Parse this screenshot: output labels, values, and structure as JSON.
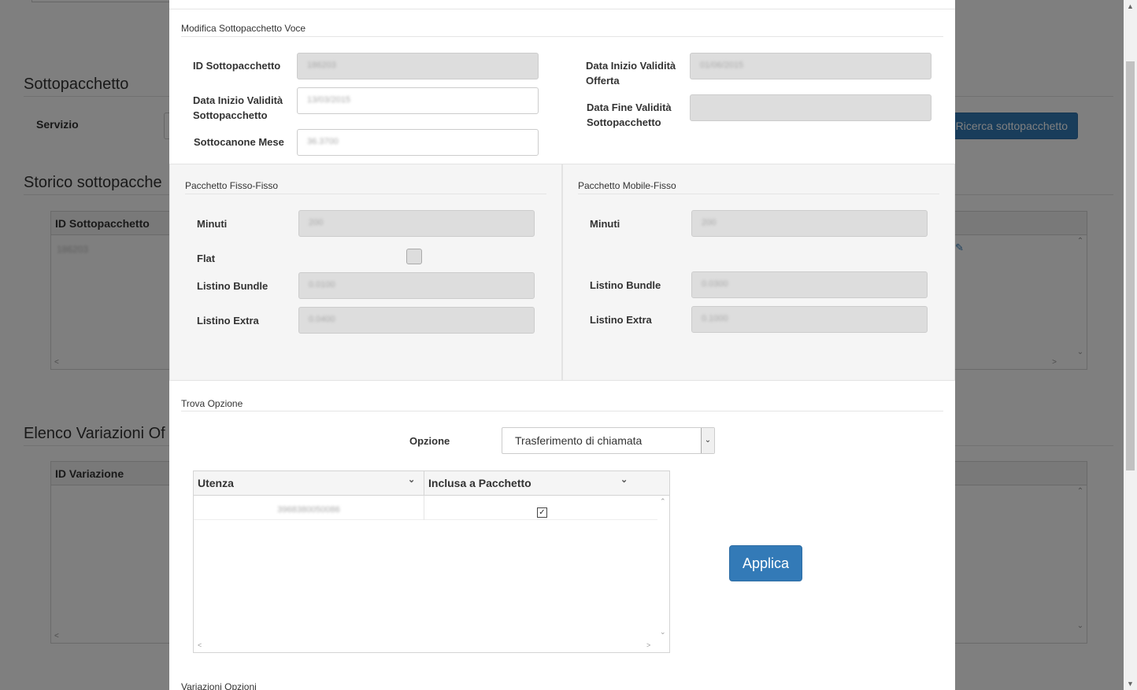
{
  "background": {
    "section_sottopacchetto": "Sottopacchetto",
    "label_servizio": "Servizio",
    "search_button": "Ricerca sottopacchetto",
    "section_storico": "Storico sottopacche",
    "storico_grid": {
      "col_id": "ID Sottopacchetto",
      "row_id": "186203"
    },
    "section_variazioni": "Elenco Variazioni Of",
    "variazioni_grid": {
      "col_id": "ID Variazione"
    }
  },
  "modal": {
    "section_title": "Modifica Sottopacchetto Voce",
    "fields": {
      "id_sottopacchetto": {
        "label": "ID Sottopacchetto",
        "value": "186203"
      },
      "data_inizio_sotto": {
        "label": "Data Inizio Validità Sottopacchetto",
        "value": "13/03/2015"
      },
      "sottocanone": {
        "label": "Sottocanone Mese",
        "value": "36.3700"
      },
      "data_inizio_offerta": {
        "label": "Data Inizio Validità Offerta",
        "value": "01/06/2015"
      },
      "data_fine_sotto": {
        "label": "Data Fine Validità Sottopacchetto",
        "value": ""
      }
    },
    "fisso": {
      "title": "Pacchetto Fisso-Fisso",
      "minuti_label": "Minuti",
      "minuti": "200",
      "flat_label": "Flat",
      "bundle_label": "Listino Bundle",
      "bundle": "0.0100",
      "extra_label": "Listino Extra",
      "extra": "0.0400"
    },
    "mobile": {
      "title": "Pacchetto Mobile-Fisso",
      "minuti_label": "Minuti",
      "minuti": "200",
      "bundle_label": "Listino Bundle",
      "bundle": "0.0300",
      "extra_label": "Listino Extra",
      "extra": "0.1000"
    },
    "trova": {
      "title": "Trova Opzione",
      "opzione_label": "Opzione",
      "opzione_selected": "Trasferimento di chiamata",
      "grid": {
        "col_utenza": "Utenza",
        "col_inclusa": "Inclusa a Pacchetto",
        "rows": [
          {
            "utenza": "3968380050086",
            "inclusa": true
          }
        ]
      },
      "apply_button": "Applica"
    },
    "next_section_title": "Variazioni Opzioni"
  },
  "colors": {
    "primary_button": "#337ab7",
    "readonly_field": "#dddddd",
    "panel_bg": "#f5f5f5"
  }
}
